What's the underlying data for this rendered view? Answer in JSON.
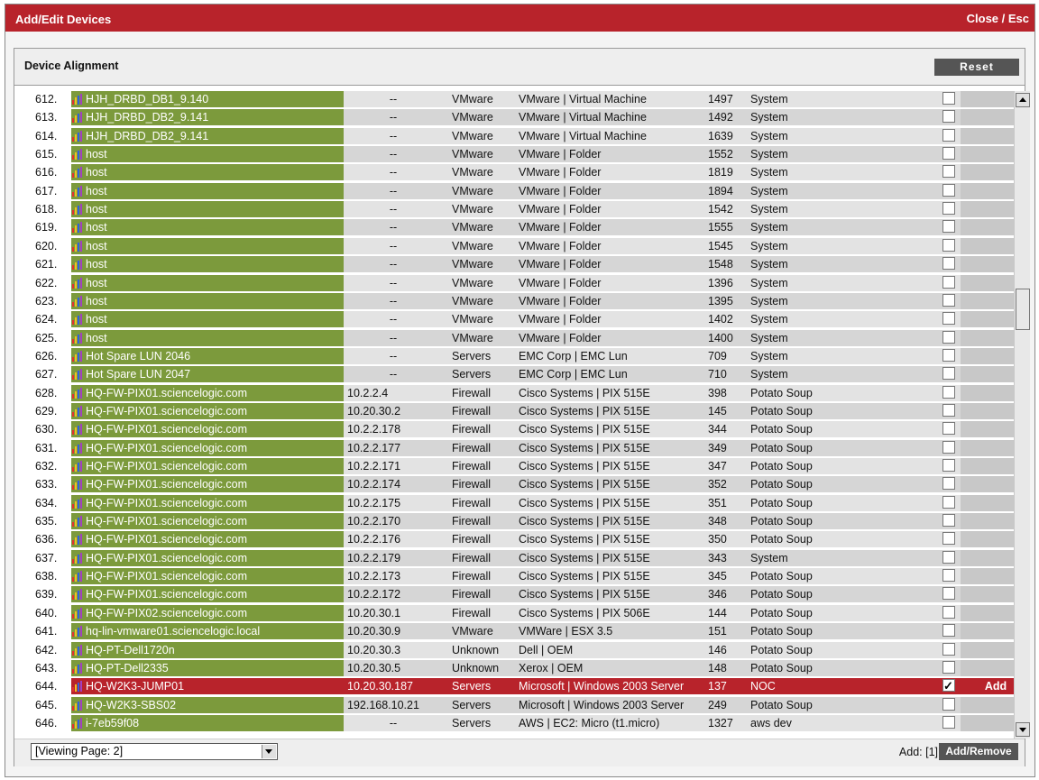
{
  "window": {
    "title": "Add/Edit Devices",
    "close_label": "Close / Esc"
  },
  "panel": {
    "title": "Device Alignment",
    "reset_label": "Reset"
  },
  "colors": {
    "titlebar": "#b8232b",
    "device_cell": "#7c9a3c",
    "selected_row": "#b8232b"
  },
  "rows": [
    {
      "num": "612.",
      "name": "HJH_DRBD_DB1_9.140",
      "ip": "--",
      "cls": "VMware",
      "desc": "VMware | Virtual Machine",
      "id": "1497",
      "org": "System",
      "checked": false,
      "action": ""
    },
    {
      "num": "613.",
      "name": "HJH_DRBD_DB2_9.141",
      "ip": "--",
      "cls": "VMware",
      "desc": "VMware | Virtual Machine",
      "id": "1492",
      "org": "System",
      "checked": false,
      "action": ""
    },
    {
      "num": "614.",
      "name": "HJH_DRBD_DB2_9.141",
      "ip": "--",
      "cls": "VMware",
      "desc": "VMware | Virtual Machine",
      "id": "1639",
      "org": "System",
      "checked": false,
      "action": ""
    },
    {
      "num": "615.",
      "name": "host",
      "ip": "--",
      "cls": "VMware",
      "desc": "VMware | Folder",
      "id": "1552",
      "org": "System",
      "checked": false,
      "action": ""
    },
    {
      "num": "616.",
      "name": "host",
      "ip": "--",
      "cls": "VMware",
      "desc": "VMware | Folder",
      "id": "1819",
      "org": "System",
      "checked": false,
      "action": ""
    },
    {
      "num": "617.",
      "name": "host",
      "ip": "--",
      "cls": "VMware",
      "desc": "VMware | Folder",
      "id": "1894",
      "org": "System",
      "checked": false,
      "action": ""
    },
    {
      "num": "618.",
      "name": "host",
      "ip": "--",
      "cls": "VMware",
      "desc": "VMware | Folder",
      "id": "1542",
      "org": "System",
      "checked": false,
      "action": ""
    },
    {
      "num": "619.",
      "name": "host",
      "ip": "--",
      "cls": "VMware",
      "desc": "VMware | Folder",
      "id": "1555",
      "org": "System",
      "checked": false,
      "action": ""
    },
    {
      "num": "620.",
      "name": "host",
      "ip": "--",
      "cls": "VMware",
      "desc": "VMware | Folder",
      "id": "1545",
      "org": "System",
      "checked": false,
      "action": ""
    },
    {
      "num": "621.",
      "name": "host",
      "ip": "--",
      "cls": "VMware",
      "desc": "VMware | Folder",
      "id": "1548",
      "org": "System",
      "checked": false,
      "action": ""
    },
    {
      "num": "622.",
      "name": "host",
      "ip": "--",
      "cls": "VMware",
      "desc": "VMware | Folder",
      "id": "1396",
      "org": "System",
      "checked": false,
      "action": ""
    },
    {
      "num": "623.",
      "name": "host",
      "ip": "--",
      "cls": "VMware",
      "desc": "VMware | Folder",
      "id": "1395",
      "org": "System",
      "checked": false,
      "action": ""
    },
    {
      "num": "624.",
      "name": "host",
      "ip": "--",
      "cls": "VMware",
      "desc": "VMware | Folder",
      "id": "1402",
      "org": "System",
      "checked": false,
      "action": ""
    },
    {
      "num": "625.",
      "name": "host",
      "ip": "--",
      "cls": "VMware",
      "desc": "VMware | Folder",
      "id": "1400",
      "org": "System",
      "checked": false,
      "action": ""
    },
    {
      "num": "626.",
      "name": "Hot Spare LUN 2046",
      "ip": "--",
      "cls": "Servers",
      "desc": "EMC Corp | EMC Lun",
      "id": "709",
      "org": "System",
      "checked": false,
      "action": ""
    },
    {
      "num": "627.",
      "name": "Hot Spare LUN 2047",
      "ip": "--",
      "cls": "Servers",
      "desc": "EMC Corp | EMC Lun",
      "id": "710",
      "org": "System",
      "checked": false,
      "action": ""
    },
    {
      "num": "628.",
      "name": "HQ-FW-PIX01.sciencelogic.com",
      "ip": "10.2.2.4",
      "cls": "Firewall",
      "desc": "Cisco Systems | PIX 515E",
      "id": "398",
      "org": "Potato Soup",
      "checked": false,
      "action": ""
    },
    {
      "num": "629.",
      "name": "HQ-FW-PIX01.sciencelogic.com",
      "ip": "10.20.30.2",
      "cls": "Firewall",
      "desc": "Cisco Systems | PIX 515E",
      "id": "145",
      "org": "Potato Soup",
      "checked": false,
      "action": ""
    },
    {
      "num": "630.",
      "name": "HQ-FW-PIX01.sciencelogic.com",
      "ip": "10.2.2.178",
      "cls": "Firewall",
      "desc": "Cisco Systems | PIX 515E",
      "id": "344",
      "org": "Potato Soup",
      "checked": false,
      "action": ""
    },
    {
      "num": "631.",
      "name": "HQ-FW-PIX01.sciencelogic.com",
      "ip": "10.2.2.177",
      "cls": "Firewall",
      "desc": "Cisco Systems | PIX 515E",
      "id": "349",
      "org": "Potato Soup",
      "checked": false,
      "action": ""
    },
    {
      "num": "632.",
      "name": "HQ-FW-PIX01.sciencelogic.com",
      "ip": "10.2.2.171",
      "cls": "Firewall",
      "desc": "Cisco Systems | PIX 515E",
      "id": "347",
      "org": "Potato Soup",
      "checked": false,
      "action": ""
    },
    {
      "num": "633.",
      "name": "HQ-FW-PIX01.sciencelogic.com",
      "ip": "10.2.2.174",
      "cls": "Firewall",
      "desc": "Cisco Systems | PIX 515E",
      "id": "352",
      "org": "Potato Soup",
      "checked": false,
      "action": ""
    },
    {
      "num": "634.",
      "name": "HQ-FW-PIX01.sciencelogic.com",
      "ip": "10.2.2.175",
      "cls": "Firewall",
      "desc": "Cisco Systems | PIX 515E",
      "id": "351",
      "org": "Potato Soup",
      "checked": false,
      "action": ""
    },
    {
      "num": "635.",
      "name": "HQ-FW-PIX01.sciencelogic.com",
      "ip": "10.2.2.170",
      "cls": "Firewall",
      "desc": "Cisco Systems | PIX 515E",
      "id": "348",
      "org": "Potato Soup",
      "checked": false,
      "action": ""
    },
    {
      "num": "636.",
      "name": "HQ-FW-PIX01.sciencelogic.com",
      "ip": "10.2.2.176",
      "cls": "Firewall",
      "desc": "Cisco Systems | PIX 515E",
      "id": "350",
      "org": "Potato Soup",
      "checked": false,
      "action": ""
    },
    {
      "num": "637.",
      "name": "HQ-FW-PIX01.sciencelogic.com",
      "ip": "10.2.2.179",
      "cls": "Firewall",
      "desc": "Cisco Systems | PIX 515E",
      "id": "343",
      "org": "System",
      "checked": false,
      "action": ""
    },
    {
      "num": "638.",
      "name": "HQ-FW-PIX01.sciencelogic.com",
      "ip": "10.2.2.173",
      "cls": "Firewall",
      "desc": "Cisco Systems | PIX 515E",
      "id": "345",
      "org": "Potato Soup",
      "checked": false,
      "action": ""
    },
    {
      "num": "639.",
      "name": "HQ-FW-PIX01.sciencelogic.com",
      "ip": "10.2.2.172",
      "cls": "Firewall",
      "desc": "Cisco Systems | PIX 515E",
      "id": "346",
      "org": "Potato Soup",
      "checked": false,
      "action": ""
    },
    {
      "num": "640.",
      "name": "HQ-FW-PIX02.sciencelogic.com",
      "ip": "10.20.30.1",
      "cls": "Firewall",
      "desc": "Cisco Systems | PIX 506E",
      "id": "144",
      "org": "Potato Soup",
      "checked": false,
      "action": ""
    },
    {
      "num": "641.",
      "name": "hq-lin-vmware01.sciencelogic.local",
      "ip": "10.20.30.9",
      "cls": "VMware",
      "desc": "VMWare | ESX 3.5",
      "id": "151",
      "org": "Potato Soup",
      "checked": false,
      "action": ""
    },
    {
      "num": "642.",
      "name": "HQ-PT-Dell1720n",
      "ip": "10.20.30.3",
      "cls": "Unknown",
      "desc": "Dell | OEM",
      "id": "146",
      "org": "Potato Soup",
      "checked": false,
      "action": ""
    },
    {
      "num": "643.",
      "name": "HQ-PT-Dell2335",
      "ip": "10.20.30.5",
      "cls": "Unknown",
      "desc": "Xerox | OEM",
      "id": "148",
      "org": "Potato Soup",
      "checked": false,
      "action": ""
    },
    {
      "num": "644.",
      "name": "HQ-W2K3-JUMP01",
      "ip": "10.20.30.187",
      "cls": "Servers",
      "desc": "Microsoft | Windows 2003 Server",
      "id": "137",
      "org": "NOC",
      "checked": true,
      "action": "Add",
      "selected": true
    },
    {
      "num": "645.",
      "name": "HQ-W2K3-SBS02",
      "ip": "192.168.10.21",
      "cls": "Servers",
      "desc": "Microsoft | Windows 2003 Server",
      "id": "249",
      "org": "Potato Soup",
      "checked": false,
      "action": ""
    },
    {
      "num": "646.",
      "name": "i-7eb59f08",
      "ip": "--",
      "cls": "Servers",
      "desc": "AWS | EC2: Micro (t1.micro)",
      "id": "1327",
      "org": "aws dev",
      "checked": false,
      "action": ""
    }
  ],
  "footer": {
    "page_select": "[Viewing Page: 2]",
    "add_count": "Add: [1]",
    "add_remove_label": "Add/Remove"
  }
}
